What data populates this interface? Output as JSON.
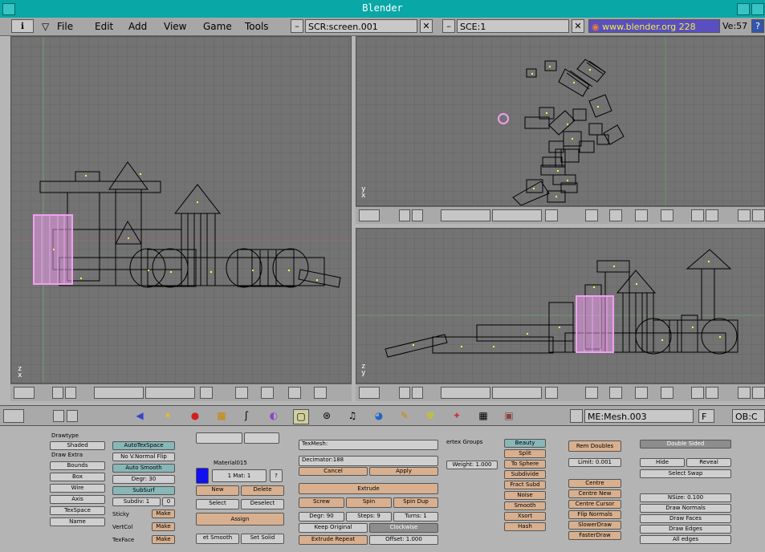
{
  "window": {
    "title": "Blender"
  },
  "menubar": {
    "menus": [
      "File",
      "Edit",
      "Add",
      "View",
      "Game",
      "Tools"
    ],
    "screen_field": "SCR:screen.001",
    "scene_field": "SCE:1",
    "url": "www.blender.org 228",
    "stats": "Ve:57"
  },
  "viewports": {
    "left": {
      "axis_top": "z",
      "axis_bottom": "x"
    },
    "top_right": {
      "axis_top": "y",
      "axis_bottom": "x"
    },
    "bottom_right": {
      "axis_top": "z",
      "axis_bottom": "y"
    }
  },
  "buttons_header": {
    "mesh_field": "ME:Mesh.003",
    "f_button": "F",
    "ob_field": "OB:C"
  },
  "edit_panel": {
    "col1": {
      "drawtype_label": "Drawtype",
      "drawtype_value": "Shaded",
      "draw_extra_label": "Draw Extra",
      "bounds": "Bounds",
      "box": "Box",
      "wire": "Wire",
      "axis": "Axis",
      "texspace": "TexSpace",
      "name": "Name"
    },
    "col2": {
      "autotexspace": "AutoTexSpace",
      "no_vnormal_flip": "No V.Normal Flip",
      "auto_smooth": "Auto Smooth",
      "degr": "Degr: 30",
      "subsurf": "SubSurf",
      "subdiv": "Subdiv: 1",
      "subdiv2": "0",
      "sticky_label": "Sticky",
      "vertcol_label": "VertCol",
      "texface_label": "TexFace",
      "make": "Make"
    },
    "col3": {
      "material_label": "Material015",
      "mat_field": "1 Mat: 1",
      "q": "?",
      "new": "New",
      "delete": "Delete",
      "select": "Select",
      "deselect": "Deselect",
      "assign": "Assign",
      "set_smooth": "et Smooth",
      "set_solid": "Set Solid"
    },
    "col4": {
      "texmesh": "TexMesh:",
      "decimator": "Decimator:188",
      "cancel": "Cancel",
      "apply": "Apply",
      "extrude": "Extrude",
      "screw": "Screw",
      "spin": "Spin",
      "spin_dup": "Spin Dup",
      "degr": "Degr: 90",
      "steps": "Steps: 9",
      "turns": "Turns: 1",
      "keep_original": "Keep Original",
      "clockwise": "Clockwise",
      "extrude_repeat": "Extrude Repeat",
      "offset": "Offset: 1.000"
    },
    "col5": {
      "vertex_groups": "ertex Groups",
      "weight": "Weight: 1.000"
    },
    "col6": {
      "beauty": "Beauty",
      "split": "Split",
      "to_sphere": "To Sphere",
      "subdivide": "Subdivide",
      "fract_subd": "Fract Subd",
      "noise": "Noise",
      "smooth": "Smooth",
      "xsort": "Xsort",
      "hash": "Hash"
    },
    "col7": {
      "rem_doubles": "Rem Doubles",
      "limit": "Limit: 0.001",
      "centre": "Centre",
      "centre_new": "Centre New",
      "centre_cursor": "Centre Cursor",
      "flip_normals": "Flip Normals",
      "slowerdraw": "SlowerDraw",
      "fasterdraw": "FasterDraw"
    },
    "col8": {
      "double_sided": "Double Sided",
      "hide": "Hide",
      "reveal": "Reveal",
      "select_swap": "Select Swap",
      "nsize": "NSize: 0.100",
      "draw_normals": "Draw Normals",
      "draw_faces": "Draw Faces",
      "draw_edges": "Draw Edges",
      "all_edges": "All edges"
    }
  },
  "colors": {
    "title_bar": "#0aa7a7",
    "viewport_bg": "#737373",
    "selection": "#f0a0f0"
  }
}
